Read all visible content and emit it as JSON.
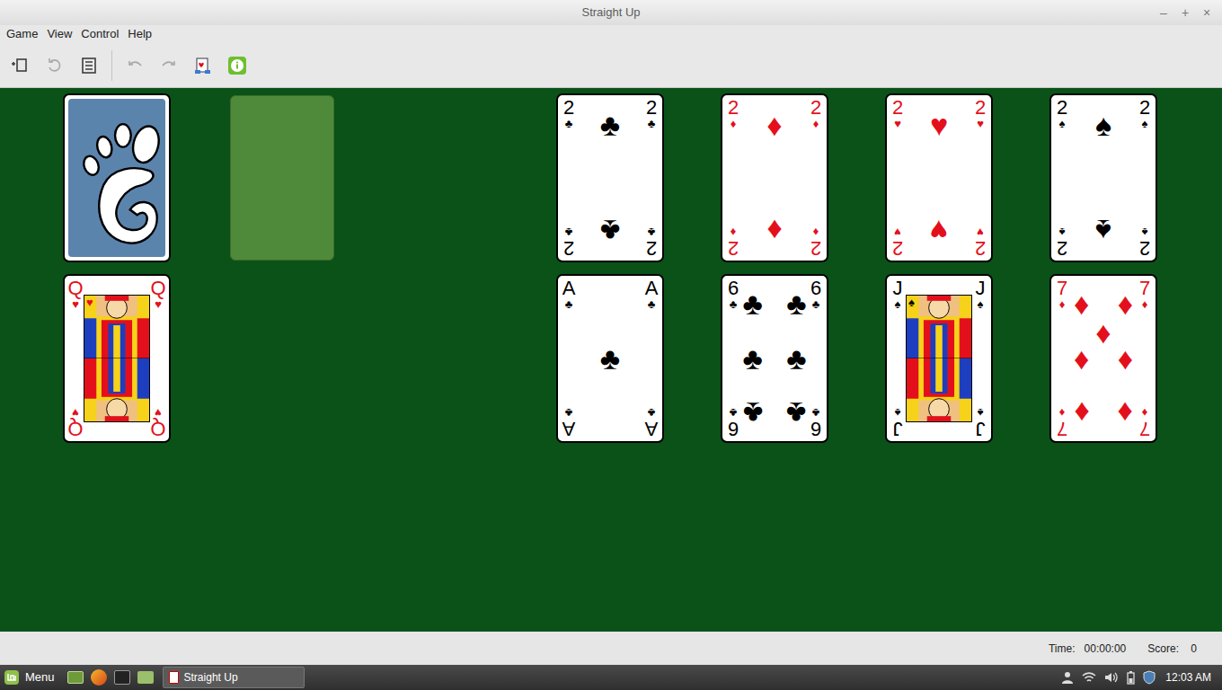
{
  "window": {
    "title": "Straight Up",
    "controls": [
      "–",
      "+",
      "×"
    ]
  },
  "menu": [
    "Game",
    "View",
    "Control",
    "Help"
  ],
  "toolbar": [
    {
      "kind": "new-game",
      "disabled": false
    },
    {
      "kind": "restart",
      "disabled": true
    },
    {
      "kind": "select-game",
      "disabled": false
    },
    {
      "kind": "undo",
      "disabled": true
    },
    {
      "kind": "redo",
      "disabled": true
    },
    {
      "kind": "deal",
      "disabled": false
    },
    {
      "kind": "hint",
      "disabled": false
    }
  ],
  "stock": {
    "empty": false
  },
  "waste": {
    "empty": true
  },
  "foundations": [
    {
      "rank": "2",
      "suit": "♣",
      "kind": "pips",
      "color": "#000000"
    },
    {
      "rank": "2",
      "suit": "♦",
      "kind": "pips",
      "color": "#e3101c"
    },
    {
      "rank": "2",
      "suit": "♥",
      "kind": "pips",
      "color": "#e3101c"
    },
    {
      "rank": "2",
      "suit": "♠",
      "kind": "pips",
      "color": "#000000"
    }
  ],
  "reserve": {
    "rank": "Q",
    "suit": "♥",
    "kind": "face",
    "color": "#e3101c"
  },
  "tableau": [
    {
      "rank": "A",
      "suit": "♣",
      "kind": "pips",
      "color": "#000000"
    },
    {
      "rank": "6",
      "suit": "♣",
      "kind": "pips",
      "color": "#000000"
    },
    {
      "rank": "J",
      "suit": "♠",
      "kind": "face",
      "color": "#000000"
    },
    {
      "rank": "7",
      "suit": "♦",
      "kind": "pips",
      "color": "#e3101c"
    }
  ],
  "status_bar": {
    "time_label": "Time:",
    "time": "00:00:00",
    "score_label": "Score:",
    "score": "0"
  },
  "taskbar": {
    "menu": "Menu",
    "windows": [
      {
        "title": "Straight Up",
        "selected": true
      }
    ],
    "clock": "12:03 AM"
  }
}
